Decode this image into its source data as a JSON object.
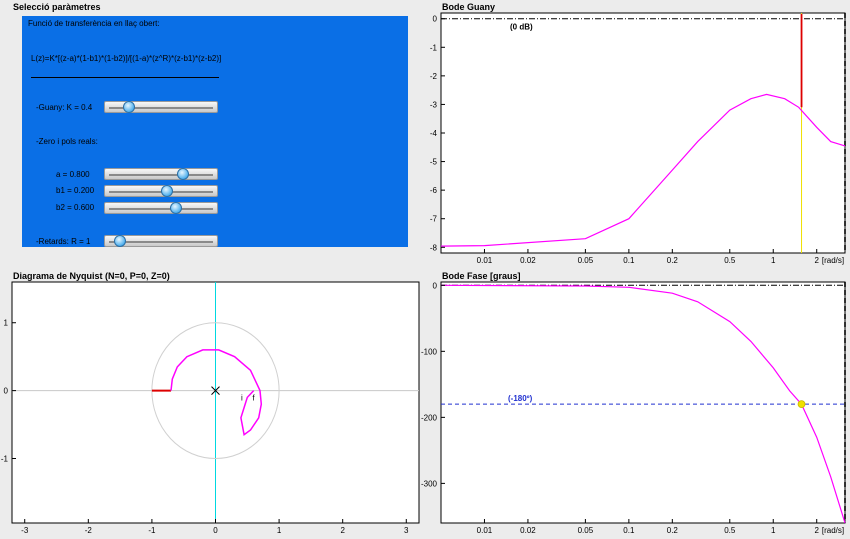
{
  "parameters": {
    "title": "Selecció paràmetres",
    "tf_heading": "Funció de transferència en llaç obert:",
    "formula": "L(z)=K*[(z-a)*(1-b1)*(1-b2)]/[(1-a)*(z^R)*(z-b1)*(z-b2)]",
    "gain_label": "-Guany: K = 0.4",
    "gain_value": 0.4,
    "zp_heading": "-Zero i pols reals:",
    "a_label": "a = 0.800",
    "b1_label": "b1 = 0.200",
    "b2_label": "b2 = 0.600",
    "delay_label": "-Retards: R = 1",
    "slider_fractions": {
      "gain": 0.15,
      "a": 0.72,
      "b1": 0.55,
      "b2": 0.65,
      "delay": 0.05
    }
  },
  "colors": {
    "panel_blue": "#0a6fe6",
    "curve": "#ff00ff",
    "critical": "#dd0000",
    "axis_cyan": "#00d8e0",
    "crossover": "#f0e000",
    "phase_ref": "#2030d0"
  },
  "bode_gain": {
    "title": "Bode Guany",
    "annotation": "(0 dB)",
    "unit_label": "[rad/s]",
    "y_ticks": [
      "0",
      "-1",
      "-2",
      "-3",
      "-4",
      "-5",
      "-6",
      "-7",
      "-8"
    ],
    "x_ticks": [
      "0.01",
      "0.02",
      "0.05",
      "0.1",
      "0.2",
      "0.5",
      "1",
      "2"
    ]
  },
  "nyquist": {
    "title": "Diagrama de Nyquist (N=0, P=0, Z=0)",
    "y_ticks": [
      "1",
      "0",
      "-1"
    ],
    "x_ticks": [
      "-3",
      "-2",
      "-1",
      "0",
      "1",
      "2",
      "3"
    ],
    "start_label": "i",
    "end_label": "f"
  },
  "bode_phase": {
    "title": "Bode Fase [graus]",
    "annotation": "(-180º)",
    "unit_label": "[rad/s]",
    "y_ticks": [
      "0",
      "-100",
      "-200",
      "-300"
    ],
    "x_ticks": [
      "0.01",
      "0.02",
      "0.05",
      "0.1",
      "0.2",
      "0.5",
      "1",
      "2"
    ]
  },
  "chart_data": [
    {
      "type": "line",
      "title": "Bode Guany",
      "xlabel": "[rad/s]",
      "x_scale": "log",
      "xlim": [
        0.005,
        3.14
      ],
      "ylim": [
        -8.2,
        0.2
      ],
      "series": [
        {
          "x": [
            0.005,
            0.01,
            0.05,
            0.1,
            0.2,
            0.3,
            0.5,
            0.7,
            0.9,
            1.2,
            1.5,
            2,
            2.5,
            3.14
          ],
          "values": [
            -7.96,
            -7.94,
            -7.7,
            -7.0,
            -5.3,
            -4.3,
            -3.2,
            -2.8,
            -2.65,
            -2.8,
            -3.1,
            -3.8,
            -4.3,
            -4.45
          ]
        }
      ],
      "reference_lines": {
        "y_dash_dot": 0,
        "x_dashed": 3.14,
        "x_red": 1.57,
        "x_yellow": 1.57
      }
    },
    {
      "type": "line",
      "title": "Diagrama de Nyquist (N=0, P=0, Z=0)",
      "xlim": [
        -3.2,
        3.2
      ],
      "ylim": [
        -1.95,
        1.6
      ],
      "unit_circle": true,
      "critical_segment": [
        [
          -1.0,
          0.0
        ],
        [
          -0.7,
          0.0
        ]
      ],
      "series": [
        {
          "x": [
            -0.7,
            -0.68,
            -0.6,
            -0.45,
            -0.2,
            0.05,
            0.3,
            0.55,
            0.7,
            0.72,
            0.68,
            0.55,
            0.45,
            0.4,
            0.5,
            0.6
          ],
          "values": [
            0,
            0.17,
            0.35,
            0.5,
            0.6,
            0.6,
            0.5,
            0.3,
            0.0,
            -0.2,
            -0.4,
            -0.58,
            -0.65,
            -0.4,
            -0.1,
            0.0
          ]
        }
      ]
    },
    {
      "type": "line",
      "title": "Bode Fase [graus]",
      "xlabel": "[rad/s]",
      "x_scale": "log",
      "xlim": [
        0.005,
        3.14
      ],
      "ylim": [
        -360,
        5
      ],
      "series": [
        {
          "x": [
            0.005,
            0.05,
            0.1,
            0.2,
            0.3,
            0.5,
            0.7,
            1.0,
            1.3,
            1.57,
            2.0,
            2.5,
            3.14
          ],
          "values": [
            0,
            -1,
            -3,
            -12,
            -25,
            -55,
            -85,
            -125,
            -160,
            -180,
            -230,
            -290,
            -360
          ]
        }
      ],
      "reference_lines": {
        "y_dashed": -180,
        "y_dash_dot": 0,
        "x_dashed": 3.14
      },
      "marker": {
        "x": 1.57,
        "y": -180
      }
    }
  ]
}
